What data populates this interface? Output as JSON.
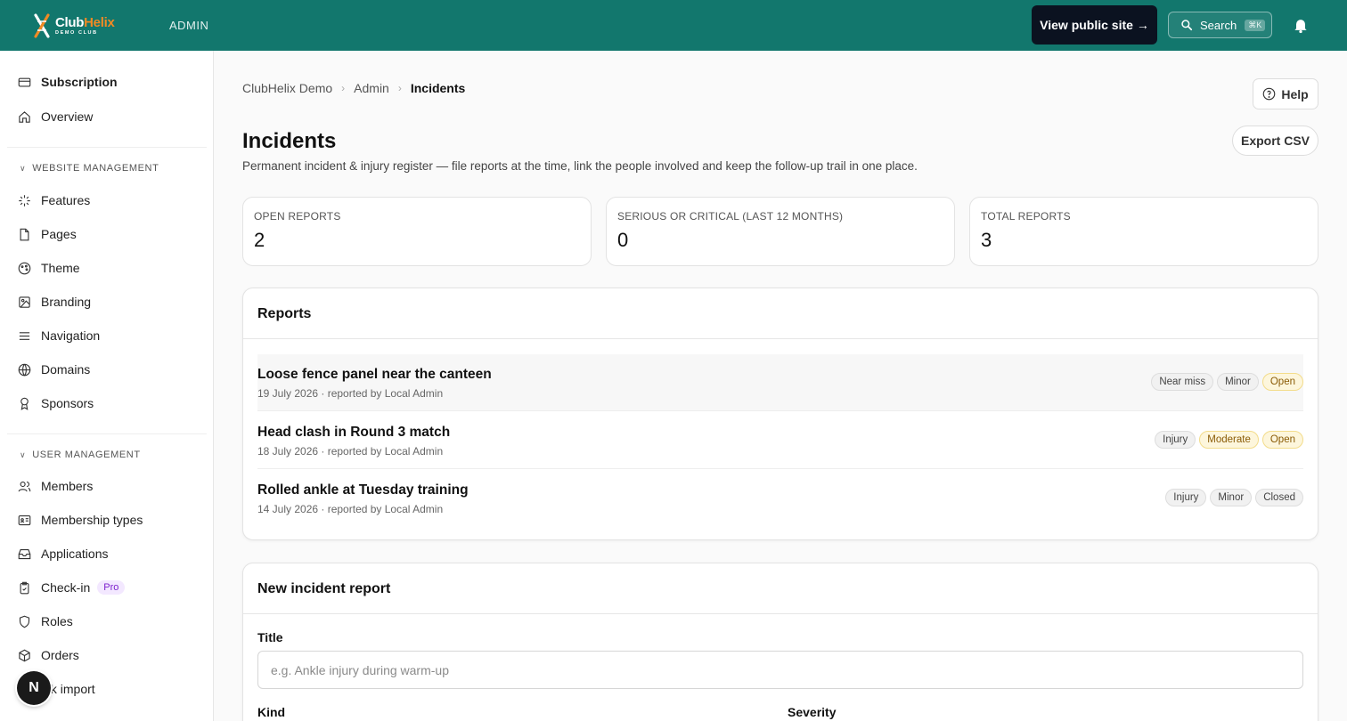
{
  "header": {
    "logo_name_1": "Club",
    "logo_name_2": "Helix",
    "logo_sub": "DEMO CLUB",
    "admin_label": "ADMIN",
    "public_site_label": "View public site →",
    "search_label": "Search",
    "search_shortcut": "⌘K",
    "accent_color": "#12776d"
  },
  "sidebar": {
    "top_items": [
      {
        "label": "Subscription",
        "icon": "credit-card-icon"
      },
      {
        "label": "Overview",
        "icon": "home-icon"
      }
    ],
    "website_section": "WEBSITE MANAGEMENT",
    "website_items": [
      {
        "label": "Features",
        "icon": "sparkle-icon"
      },
      {
        "label": "Pages",
        "icon": "file-icon"
      },
      {
        "label": "Theme",
        "icon": "palette-icon"
      },
      {
        "label": "Branding",
        "icon": "image-icon"
      },
      {
        "label": "Navigation",
        "icon": "menu-icon"
      },
      {
        "label": "Domains",
        "icon": "globe-icon"
      },
      {
        "label": "Sponsors",
        "icon": "award-icon"
      }
    ],
    "user_section": "USER MANAGEMENT",
    "user_items": [
      {
        "label": "Members",
        "icon": "users-icon"
      },
      {
        "label": "Membership types",
        "icon": "id-card-icon"
      },
      {
        "label": "Applications",
        "icon": "inbox-icon"
      },
      {
        "label": "Check-in",
        "icon": "clipboard-check-icon",
        "badge": "Pro"
      },
      {
        "label": "Roles",
        "icon": "shield-icon"
      },
      {
        "label": "Orders",
        "icon": "package-icon"
      },
      {
        "label": "ulk import",
        "icon": "upload-icon"
      }
    ],
    "fab_letter": "N"
  },
  "breadcrumb": [
    "ClubHelix Demo",
    "Admin",
    "Incidents"
  ],
  "help_label": "Help",
  "export_label": "Export CSV",
  "page": {
    "title": "Incidents",
    "subtitle": "Permanent incident & injury register — file reports at the time, link the people involved and keep the follow-up trail in one place."
  },
  "stats": [
    {
      "label": "OPEN REPORTS",
      "value": "2"
    },
    {
      "label": "SERIOUS OR CRITICAL (LAST 12 MONTHS)",
      "value": "0"
    },
    {
      "label": "TOTAL REPORTS",
      "value": "3"
    }
  ],
  "reports_card": {
    "title": "Reports",
    "items": [
      {
        "title": "Loose fence panel near the canteen",
        "meta": "19 July 2026 · reported by Local Admin",
        "tags": [
          {
            "text": "Near miss",
            "tone": "neutral"
          },
          {
            "text": "Minor",
            "tone": "neutral"
          },
          {
            "text": "Open",
            "tone": "amber"
          }
        ]
      },
      {
        "title": "Head clash in Round 3 match",
        "meta": "18 July 2026 · reported by Local Admin",
        "tags": [
          {
            "text": "Injury",
            "tone": "neutral"
          },
          {
            "text": "Moderate",
            "tone": "amber"
          },
          {
            "text": "Open",
            "tone": "amber"
          }
        ]
      },
      {
        "title": "Rolled ankle at Tuesday training",
        "meta": "14 July 2026 · reported by Local Admin",
        "tags": [
          {
            "text": "Injury",
            "tone": "neutral"
          },
          {
            "text": "Minor",
            "tone": "neutral"
          },
          {
            "text": "Closed",
            "tone": "neutral"
          }
        ]
      }
    ]
  },
  "new_report": {
    "title": "New incident report",
    "title_label": "Title",
    "title_placeholder": "e.g. Ankle injury during warm-up",
    "title_value": "",
    "kind_label": "Kind",
    "severity_label": "Severity"
  }
}
